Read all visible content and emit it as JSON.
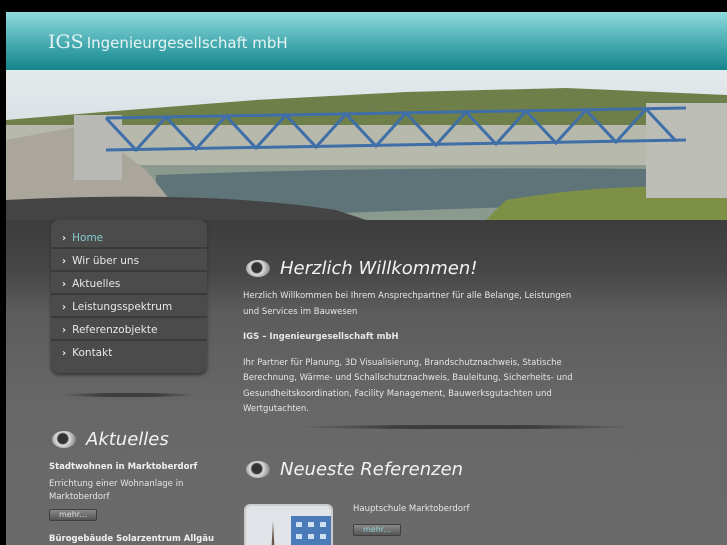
{
  "header": {
    "logo_abbr": "IGS",
    "logo_name": "Ingenieurgesellschaft mbH"
  },
  "nav": [
    {
      "label": "Home",
      "active": true
    },
    {
      "label": "Wir über uns"
    },
    {
      "label": "Aktuelles"
    },
    {
      "label": "Leistungsspektrum"
    },
    {
      "label": "Referenzobjekte"
    },
    {
      "label": "Kontakt"
    }
  ],
  "welcome": {
    "title": "Herzlich Willkommen!",
    "p1": "Herzlich Willkommen bei Ihrem Ansprechpartner für alle Belange, Leistungen und Services im Bauwesen",
    "p2": "IGS – Ingenieurgesellschaft mbH",
    "p3": "Ihr Partner für Planung, 3D Visualisierung, Brandschutznachweis, Statische Berechnung, Wärme- und Schallschutznachweis, Bauleitung, Sicherheits- und Gesundheitskoordination, Facility Management, Bauwerksgutachten und Wertgutachten."
  },
  "news": {
    "title": "Aktuelles",
    "items": [
      {
        "title": "Stadtwohnen in Marktoberdorf",
        "text": "Errichtung einer Wohnanlage in Marktoberdorf",
        "more": "mehr..."
      },
      {
        "title": "Bürogebäude Solarzentrum Allgäu"
      }
    ]
  },
  "refs": {
    "title": "Neueste Referenzen",
    "items": [
      {
        "title": "Hauptschule Marktoberdorf",
        "more": "mehr..."
      }
    ]
  }
}
